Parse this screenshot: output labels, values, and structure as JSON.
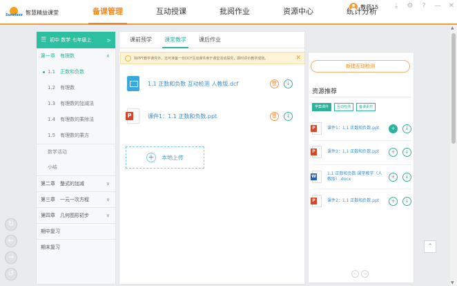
{
  "app": {
    "logo_text": "Sunclass",
    "name": "智慧精益课堂",
    "colors": {
      "accent": "#f2891c",
      "primary": "#2ab29a",
      "link": "#3a8fd2"
    }
  },
  "nav": [
    "备课管理",
    "互动授课",
    "批阅作业",
    "资源中心",
    "统计分析"
  ],
  "user": {
    "name": "教师15"
  },
  "tree": {
    "header": "初中 数学 七年级上",
    "items": [
      {
        "label": "第一章　有理数",
        "kind": "chapter-open",
        "chev": "∧"
      },
      {
        "label": "1.1　正数和负数",
        "kind": "sub active"
      },
      {
        "label": "1.2　有理数",
        "kind": "sub"
      },
      {
        "label": "1.3　有理数的加减法",
        "kind": "sub"
      },
      {
        "label": "1.4　有理数的乘除法",
        "kind": "sub"
      },
      {
        "label": "1.5　有理数的乘方",
        "kind": "sub"
      },
      {
        "label": "数学活动",
        "kind": "lesson"
      },
      {
        "label": "小结",
        "kind": "lesson"
      },
      {
        "label": "第二章　整式的加减",
        "kind": "chapter",
        "chev": "∨"
      },
      {
        "label": "第三章　一元一次方程",
        "kind": "chapter",
        "chev": "∨"
      },
      {
        "label": "第四章　几何图形初步",
        "kind": "chapter",
        "chev": "∨"
      },
      {
        "label": "期中复习",
        "kind": "chapter"
      },
      {
        "label": "期末复习",
        "kind": "chapter"
      }
    ]
  },
  "tabs": [
    "课前预学",
    "课堂教学",
    "课后作业"
  ],
  "notice": "除PPT教学课件外，还可准备一份DCF互动课件用于课堂活动探究，即时评价教学成效。",
  "files": [
    {
      "name": "1.1 正数和负数 互动检测 人教版.dcf",
      "type": "dcf"
    },
    {
      "name": "课件1：1.1 正数和负数.ppt",
      "type": "ppt"
    }
  ],
  "upload_label": "本地上传",
  "right": {
    "new_button": "新建互动检测",
    "title": "资源推荐",
    "filters": [
      "学案课件",
      "互动检测",
      "备课素材"
    ],
    "resources": [
      {
        "name": "课件1：1.1 正数和负数.ppt",
        "type": "ppt"
      },
      {
        "name": "课件3：1.1 正数和负数.ppt",
        "type": "ppt"
      },
      {
        "name": "1.1 正数和负数 课堂教学（人教版）.docx",
        "type": "word"
      },
      {
        "name": "课件2：1.1 正数和负数.ppt",
        "type": "ppt"
      }
    ]
  }
}
